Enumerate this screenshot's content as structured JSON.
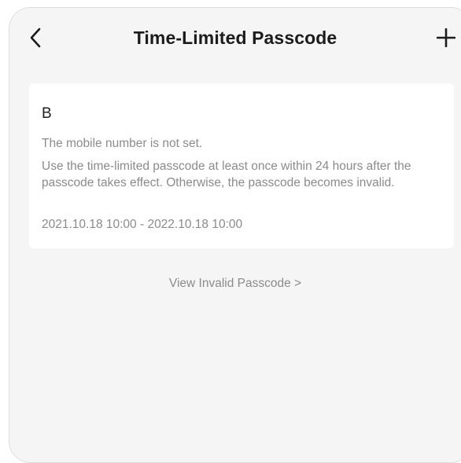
{
  "header": {
    "title": "Time-Limited Passcode",
    "back_icon": "chevron-left-icon",
    "add_icon": "plus-icon"
  },
  "passcode": {
    "name": "B",
    "mobile_status": "The mobile number is not set.",
    "usage_rule": "Use the time-limited passcode at least once within 24 hours after the passcode takes effect. Otherwise, the passcode becomes invalid.",
    "validity": "2021.10.18 10:00 - 2022.10.18 10:00"
  },
  "footer": {
    "view_invalid_label": "View Invalid Passcode >"
  },
  "colors": {
    "background": "#f5f5f5",
    "card": "#ffffff",
    "title_text": "#1c1c1c",
    "secondary_text": "#8b8b8b"
  }
}
